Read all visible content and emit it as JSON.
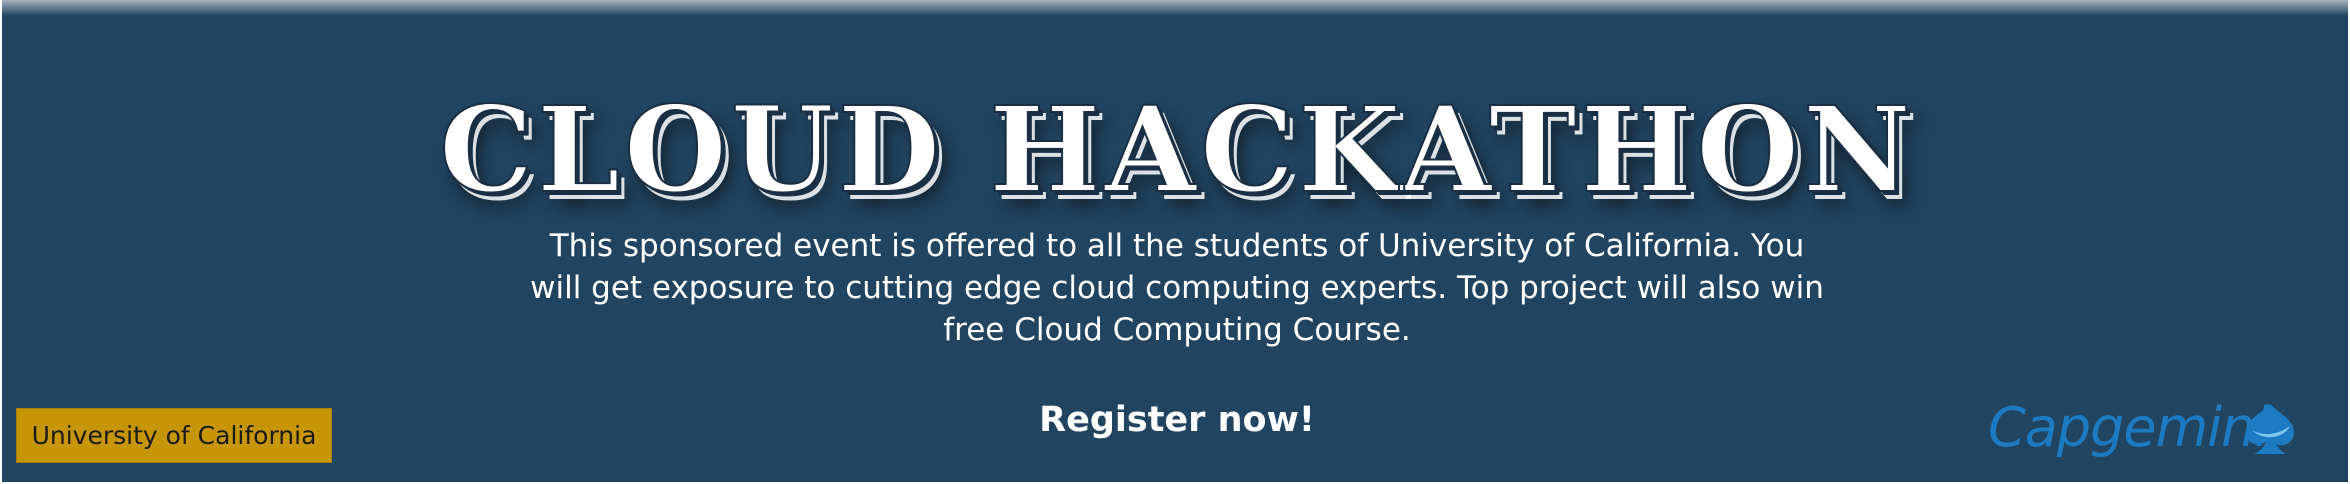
{
  "banner": {
    "title": "CLOUD HACKATHON",
    "description": "This sponsored event is offered to all the students of University of California. You will get exposure to cutting edge cloud computing experts. Top project will also win free Cloud Computing Course.",
    "cta_label": "Register now!",
    "university_badge": "University of California",
    "sponsor_logo": {
      "text": "Capgemini",
      "icon": "spade-icon",
      "color": "#1c7bc2"
    }
  },
  "colors": {
    "background": "#214460",
    "badge": "#c79607",
    "text": "#ffffff"
  }
}
